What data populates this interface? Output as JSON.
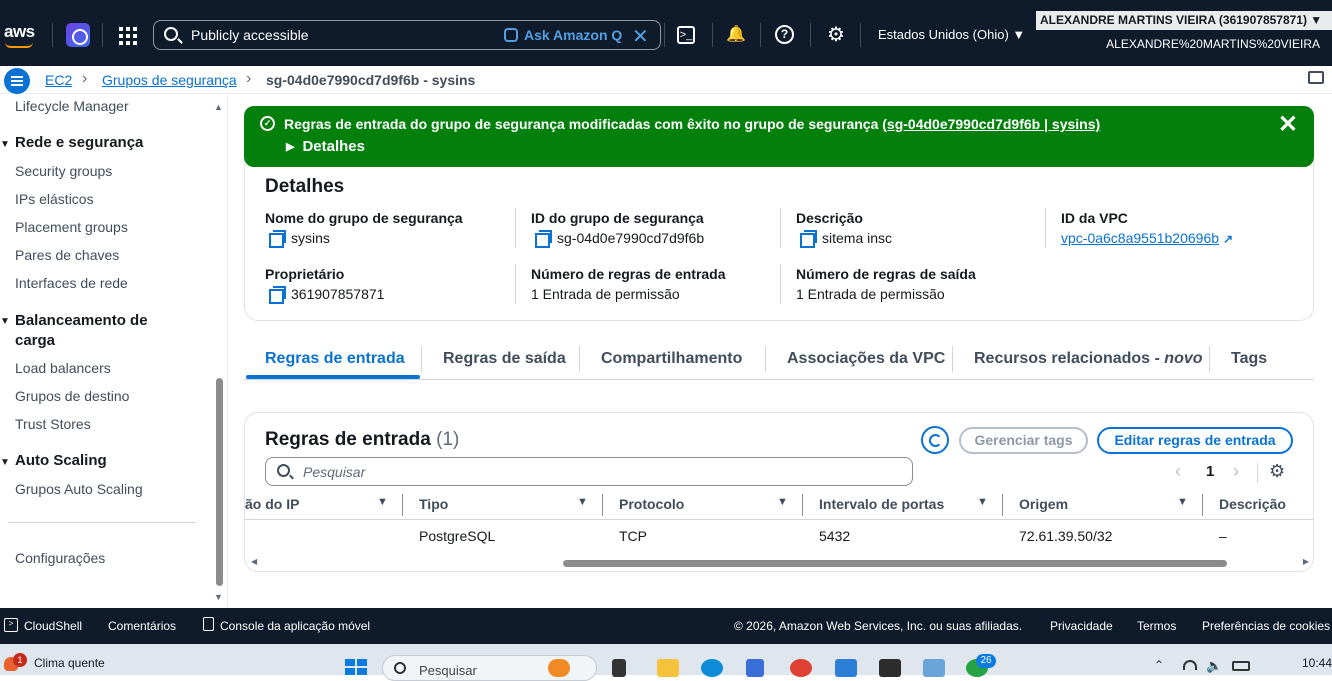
{
  "topnav": {
    "logo_text": "aws",
    "search_value": "Publicly accessible",
    "ask_q": "Ask Amazon Q",
    "region": "Estados Unidos (Ohio) ▼",
    "account_name": "ALEXANDRE MARTINS VIEIRA (361907857871) ▼",
    "account_alias": "ALEXANDRE%20MARTINS%20VIEIRA"
  },
  "breadcrumb": {
    "ec2": "EC2",
    "groups": "Grupos de segurança",
    "current": "sg-04d0e7990cd7d9f6b - sysins"
  },
  "sidebar": {
    "partial_top": "Lifecycle Manager",
    "section_network": "Rede e segurança",
    "network_items": [
      "Security groups",
      "IPs elásticos",
      "Placement groups",
      "Pares de chaves",
      "Interfaces de rede"
    ],
    "section_lb": "Balanceamento de carga",
    "lb_items": [
      "Load balancers",
      "Grupos de destino",
      "Trust Stores"
    ],
    "section_as": "Auto Scaling",
    "as_items": [
      "Grupos Auto Scaling"
    ],
    "settings": "Configurações"
  },
  "flash": {
    "message": "Regras de entrada do grupo de segurança modificadas com êxito no grupo de segurança ",
    "link": "(sg-04d0e7990cd7d9f6b | sysins)",
    "details_toggle": "Detalhes",
    "color": "#037f0c"
  },
  "details": {
    "title": "Detalhes",
    "group_name_label": "Nome do grupo de segurança",
    "group_name": "sysins",
    "group_id_label": "ID do grupo de segurança",
    "group_id": "sg-04d0e7990cd7d9f6b",
    "description_label": "Descrição",
    "description": "sitema insc",
    "vpc_label": "ID da VPC",
    "vpc_id": "vpc-0a6c8a9551b20696b",
    "owner_label": "Proprietário",
    "owner": "361907857871",
    "inbound_count_label": "Número de regras de entrada",
    "inbound_count": "1 Entrada de permissão",
    "outbound_count_label": "Número de regras de saída",
    "outbound_count": "1 Entrada de permissão"
  },
  "tabs": [
    "Regras de entrada",
    "Regras de saída",
    "Compartilhamento",
    "Associações da VPC",
    "Recursos relacionados - ",
    "Tags"
  ],
  "tab_new_badge": "novo",
  "rules": {
    "title": "Regras de entrada",
    "count": "(1)",
    "manage_tags": "Gerenciar tags",
    "edit_rules": "Editar regras de entrada",
    "search_placeholder": "Pesquisar",
    "page": "1",
    "columns": [
      "ão do IP",
      "Tipo",
      "Protocolo",
      "Intervalo de portas",
      "Origem",
      "Descrição"
    ],
    "rows": [
      {
        "type": "PostgreSQL",
        "protocol": "TCP",
        "port_range": "5432",
        "source": "72.61.39.50/32",
        "description": "–"
      }
    ]
  },
  "footer": {
    "cloudshell": "CloudShell",
    "comments": "Comentários",
    "mobile_console": "Console da aplicação móvel",
    "copyright": "© 2026, Amazon Web Services, Inc. ou suas afiliadas.",
    "privacy": "Privacidade",
    "terms": "Termos",
    "cookies": "Preferências de cookies"
  },
  "taskbar": {
    "weather_badge": "1",
    "weather": "Clima quente",
    "search": "Pesquisar",
    "app_badge": "26",
    "time": "10:44"
  }
}
